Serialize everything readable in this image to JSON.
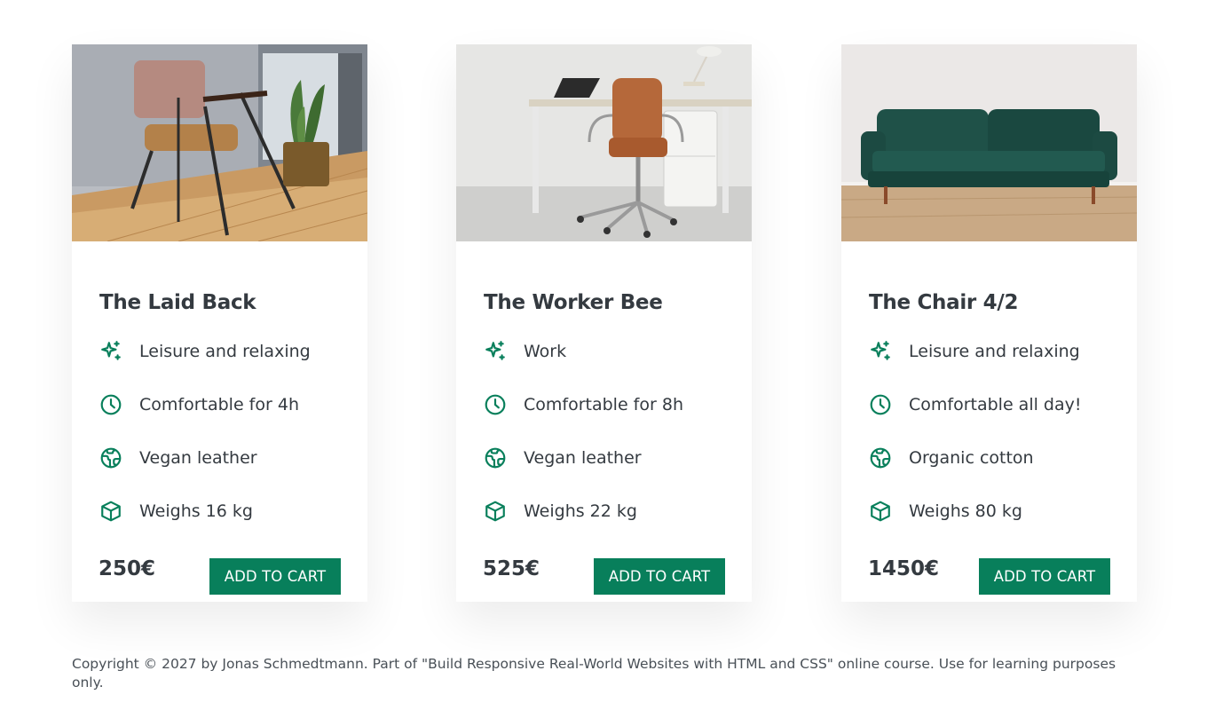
{
  "colors": {
    "accent": "#087f5b",
    "text": "#343a40",
    "muted": "#495057"
  },
  "cards": [
    {
      "image_alt": "Laid back chair by a window with a plant",
      "title": "The Laid Back",
      "attributes": [
        {
          "icon": "sparkles-icon",
          "text": "Leisure and relaxing"
        },
        {
          "icon": "clock-icon",
          "text": "Comfortable for 4h"
        },
        {
          "icon": "globe-icon",
          "text": "Vegan leather"
        },
        {
          "icon": "cube-icon",
          "text": "Weighs 16 kg"
        }
      ],
      "price": "250€",
      "button_label": "ADD TO CART"
    },
    {
      "image_alt": "Office chair at a desk",
      "title": "The Worker Bee",
      "attributes": [
        {
          "icon": "sparkles-icon",
          "text": "Work"
        },
        {
          "icon": "clock-icon",
          "text": "Comfortable for 8h"
        },
        {
          "icon": "globe-icon",
          "text": "Vegan leather"
        },
        {
          "icon": "cube-icon",
          "text": "Weighs 22 kg"
        }
      ],
      "price": "525€",
      "button_label": "ADD TO CART"
    },
    {
      "image_alt": "Green velvet sofa",
      "title": "The Chair 4/2",
      "attributes": [
        {
          "icon": "sparkles-icon",
          "text": "Leisure and relaxing"
        },
        {
          "icon": "clock-icon",
          "text": "Comfortable all day!"
        },
        {
          "icon": "globe-icon",
          "text": "Organic cotton"
        },
        {
          "icon": "cube-icon",
          "text": "Weighs 80 kg"
        }
      ],
      "price": "1450€",
      "button_label": "ADD TO CART"
    }
  ],
  "footer": {
    "copyright": "Copyright © 2027 by Jonas Schmedtmann. Part of \"Build Responsive Real-World Websites with HTML and CSS\" online course. Use for learning purposes only."
  }
}
